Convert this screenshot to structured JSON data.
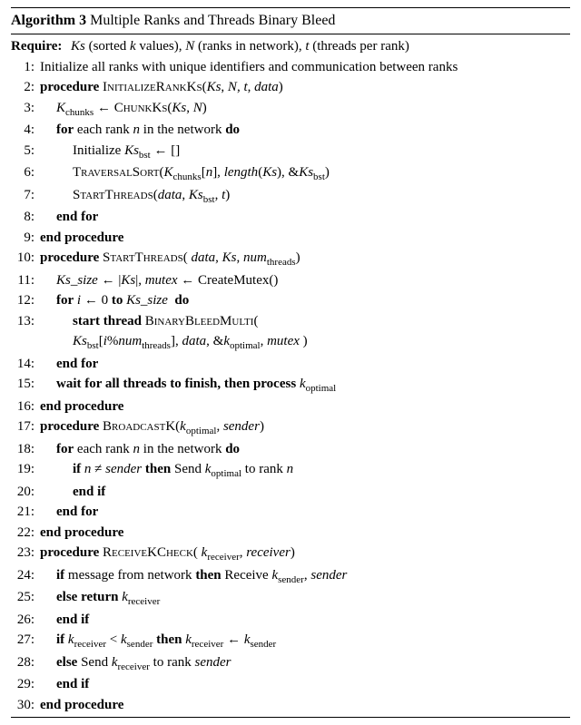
{
  "title_prefix": "Algorithm 3",
  "title_rest": " Multiple Ranks and Threads Binary Bleed",
  "require_label": "Require:",
  "require_text_html": " <span class='it'>Ks</span> (sorted <span class='it'>k</span> values), <span class='it'>N</span> (ranks in network), <span class='it'>t</span> (threads per rank)",
  "lines": [
    {
      "n": "1:",
      "html": "Initialize all ranks with unique identifiers and communication between ranks"
    },
    {
      "n": "2:",
      "html": "<span class='bf'>procedure</span> <span class='sc'>InitializeRankKs</span>(<span class='it'>Ks</span>, <span class='it'>N</span>, <span class='it'>t</span>, <span class='it'>data</span>)"
    },
    {
      "n": "3:",
      "html": "<span class='indent1'><span class='it'>K</span><span class='sub'>chunks</span> ← <span class='sc'>ChunkKs</span>(<span class='it'>Ks</span>, <span class='it'>N</span>)</span>"
    },
    {
      "n": "4:",
      "html": "<span class='indent1'><span class='bf'>for</span> each rank <span class='it'>n</span> in the network <span class='bf'>do</span></span>"
    },
    {
      "n": "5:",
      "html": "<span class='indent2'>Initialize <span class='it'>Ks</span><span class='sub'>bst</span> ← []</span>"
    },
    {
      "n": "6:",
      "html": "<span class='indent2'><span class='sc'>TraversalSort</span>(<span class='it'>K</span><span class='sub'>chunks</span>[<span class='it'>n</span>], <span class='it'>length</span>(<span class='it'>Ks</span>), &amp;<span class='it'>Ks</span><span class='sub'>bst</span>)</span>"
    },
    {
      "n": "7:",
      "html": "<span class='indent2'><span class='sc'>StartThreads</span>(<span class='it'>data</span>, <span class='it'>Ks</span><span class='sub'>bst</span>, <span class='it'>t</span>)</span>"
    },
    {
      "n": "8:",
      "html": "<span class='indent1'><span class='bf'>end for</span></span>"
    },
    {
      "n": "9:",
      "html": "<span class='bf'>end procedure</span>"
    },
    {
      "n": "10:",
      "html": "<span class='bf'>procedure</span> <span class='sc'>StartThreads</span>( <span class='it'>data</span>, <span class='it'>Ks</span>, <span class='it'>num</span><span class='sub'>threads</span>)"
    },
    {
      "n": "11:",
      "html": "<span class='indent1'><span class='it'>Ks_size</span> ← |<span class='it'>Ks</span>|, <span class='it'>mutex</span> ← CreateMutex()</span>"
    },
    {
      "n": "12:",
      "html": "<span class='indent1'><span class='bf'>for</span> <span class='it'>i</span> ← 0 <span class='bf'>to</span> <span class='it'>Ks_size</span>&nbsp; <span class='bf'>do</span></span>"
    },
    {
      "n": "13:",
      "html": "<span class='indent2'><span class='bf'>start thread</span> <span class='sc'>BinaryBleedMulti</span>(</span><br><span class='indent2'><span class='it'>Ks</span><span class='sub'>bst</span>[<span class='it'>i</span>%<span class='it'>num</span><span class='sub'>threads</span>], <span class='it'>data</span>, &amp;<span class='it'>k</span><span class='sub'>optimal</span>, <span class='it'>mutex</span> )</span>"
    },
    {
      "n": "14:",
      "html": "<span class='indent1'><span class='bf'>end for</span></span>"
    },
    {
      "n": "15:",
      "html": "<span class='indent1'><span class='bf'>wait for all threads to finish, then process</span> <span class='it'>k</span><span class='sub'>optimal</span></span>"
    },
    {
      "n": "16:",
      "html": "<span class='bf'>end procedure</span>"
    },
    {
      "n": "17:",
      "html": "<span class='bf'>procedure</span> <span class='sc'>BroadcastK</span>(<span class='it'>k</span><span class='sub'>optimal</span>, <span class='it'>sender</span>)"
    },
    {
      "n": "18:",
      "html": "<span class='indent1'><span class='bf'>for</span> each rank <span class='it'>n</span> in the network <span class='bf'>do</span></span>"
    },
    {
      "n": "19:",
      "html": "<span class='indent2'><span class='bf'>if</span> <span class='it'>n</span> ≠ <span class='it'>sender</span> <span class='bf'>then</span> Send <span class='it'>k</span><span class='sub'>optimal</span> to rank <span class='it'>n</span></span>"
    },
    {
      "n": "20:",
      "html": "<span class='indent2'><span class='bf'>end if</span></span>"
    },
    {
      "n": "21:",
      "html": "<span class='indent1'><span class='bf'>end for</span></span>"
    },
    {
      "n": "22:",
      "html": "<span class='bf'>end procedure</span>"
    },
    {
      "n": "23:",
      "html": "<span class='bf'>procedure</span> <span class='sc'>ReceiveKCheck</span>( <span class='it'>k</span><span class='sub'>receiver</span>, <span class='it'>receiver</span>)"
    },
    {
      "n": "24:",
      "html": "<span class='indent1'><span class='bf'>if</span> message from network <span class='bf'>then</span> Receive <span class='it'>k</span><span class='sub'>sender</span>, <span class='it'>sender</span></span>"
    },
    {
      "n": "25:",
      "html": "<span class='indent1'><span class='bf'>else return</span> <span class='it'>k</span><span class='sub'>receiver</span></span>"
    },
    {
      "n": "26:",
      "html": "<span class='indent1'><span class='bf'>end if</span></span>"
    },
    {
      "n": "27:",
      "html": "<span class='indent1'><span class='bf'>if</span> <span class='it'>k</span><span class='sub'>receiver</span> &lt; <span class='it'>k</span><span class='sub'>sender</span> <span class='bf'>then</span> <span class='it'>k</span><span class='sub'>receiver</span> ← <span class='it'>k</span><span class='sub'>sender</span></span>"
    },
    {
      "n": "28:",
      "html": "<span class='indent1'><span class='bf'>else</span> Send <span class='it'>k</span><span class='sub'>receiver</span> to rank <span class='it'>sender</span></span>"
    },
    {
      "n": "29:",
      "html": "<span class='indent1'><span class='bf'>end if</span></span>"
    },
    {
      "n": "30:",
      "html": "<span class='bf'>end procedure</span>"
    }
  ]
}
